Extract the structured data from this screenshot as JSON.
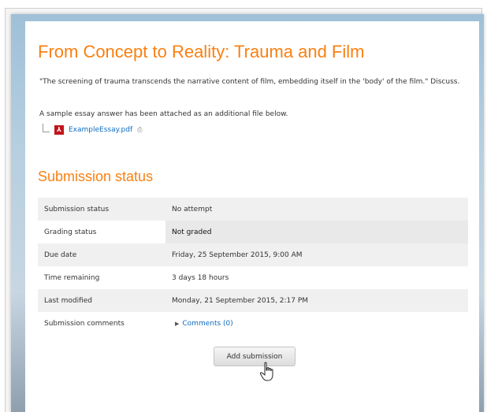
{
  "assignment": {
    "title": "From Concept to Reality: Trauma and Film",
    "intro": "\"The screening of trauma transcends the narrative content of film, embedding itself in the 'body' of the film.\" Discuss.",
    "sample_note": "A sample essay answer has been attached as an additional file below.",
    "file": {
      "name": "ExampleEssay.pdf",
      "icon": "pdf-icon"
    }
  },
  "submission": {
    "heading": "Submission status",
    "rows": [
      {
        "label": "Submission status",
        "value": "No attempt"
      },
      {
        "label": "Grading status",
        "value": "Not graded"
      },
      {
        "label": "Due date",
        "value": "Friday, 25 September 2015, 9:00 AM"
      },
      {
        "label": "Time remaining",
        "value": "3 days 18 hours"
      },
      {
        "label": "Last modified",
        "value": "Monday, 21 September 2015, 2:17 PM"
      },
      {
        "label": "Submission comments",
        "value": "Comments (0)"
      }
    ],
    "button_label": "Add submission"
  },
  "colors": {
    "accent": "#f98012",
    "link": "#0f6cbf",
    "pdf": "#c0161c"
  }
}
